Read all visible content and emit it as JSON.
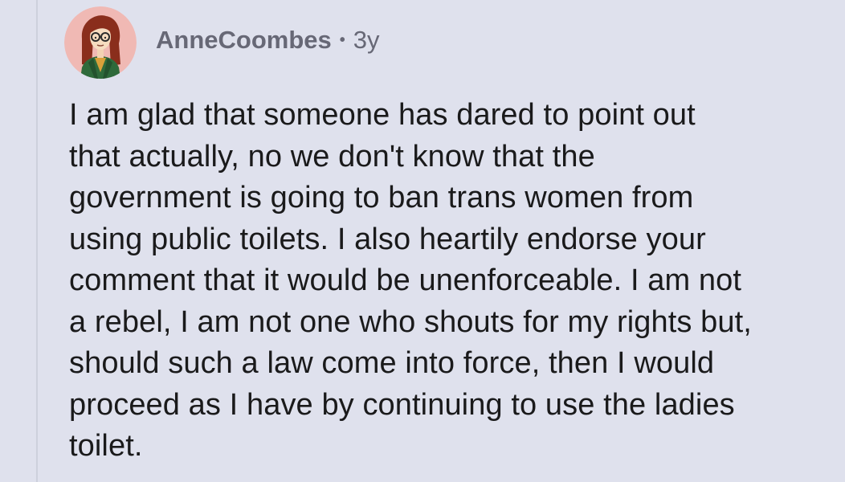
{
  "comment": {
    "avatar_icon": "cartoon-woman-avatar-icon",
    "username": "AnneCoombes",
    "separator": "•",
    "age": "3y",
    "body_lines": [
      "I am glad that someone has dared to point out",
      "that actually, no we don't know that the",
      "government is going to ban trans women from",
      "using public toilets. I also heartily endorse your",
      "comment that it would be unenforceable. I am not",
      "a rebel, I am not one who shouts for my rights but,",
      "should such a law come into force, then I would",
      "proceed as I have by continuing to use the ladies",
      "toilet."
    ]
  },
  "colors": {
    "background": "#dfe1ed",
    "text": "#1a1a1b",
    "meta_text": "#676876",
    "thread_line": "#cdd0dc",
    "avatar_bg": "#f0b9b4"
  }
}
